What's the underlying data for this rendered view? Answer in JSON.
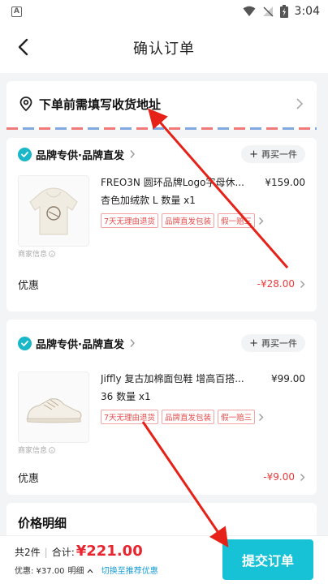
{
  "status_bar": {
    "time": "3:04"
  },
  "nav": {
    "title": "确认订单"
  },
  "address": {
    "label": "下单前需填写收货地址"
  },
  "orders": [
    {
      "shop_name": "品牌专供·品牌直发",
      "rebuy_label": "再买一件",
      "product_title": "FREO3N 圆环品牌Logo字母休...",
      "price": "¥159.00",
      "spec": "杏色加绒款 L 数量 x1",
      "tags": [
        "7天无理由退货",
        "品牌直发包装",
        "假一赔三"
      ],
      "merchant_info": "商家信息",
      "discount_label": "优惠",
      "discount_value": "-¥28.00"
    },
    {
      "shop_name": "品牌专供·品牌直发",
      "rebuy_label": "再买一件",
      "product_title": "Jiffly 复古加棉面包鞋 增高百搭...",
      "price": "¥99.00",
      "spec": "36 数量 x1",
      "tags": [
        "7天无理由退货",
        "品牌直发包装",
        "假一赔三"
      ],
      "merchant_info": "商家信息",
      "discount_label": "优惠",
      "discount_value": "-¥9.00"
    }
  ],
  "price_detail": {
    "title": "价格明细"
  },
  "bottom": {
    "count": "共2件",
    "subtotal_label": "合计:",
    "total": "¥221.00",
    "discount_text": "优惠: ¥37.00",
    "detail_label": "明细",
    "switch_label": "切换至推荐优惠",
    "submit_label": "提交订单"
  },
  "colors": {
    "accent": "#18c2d6",
    "price_red": "#e8252f",
    "arrow_red": "#e62117"
  }
}
